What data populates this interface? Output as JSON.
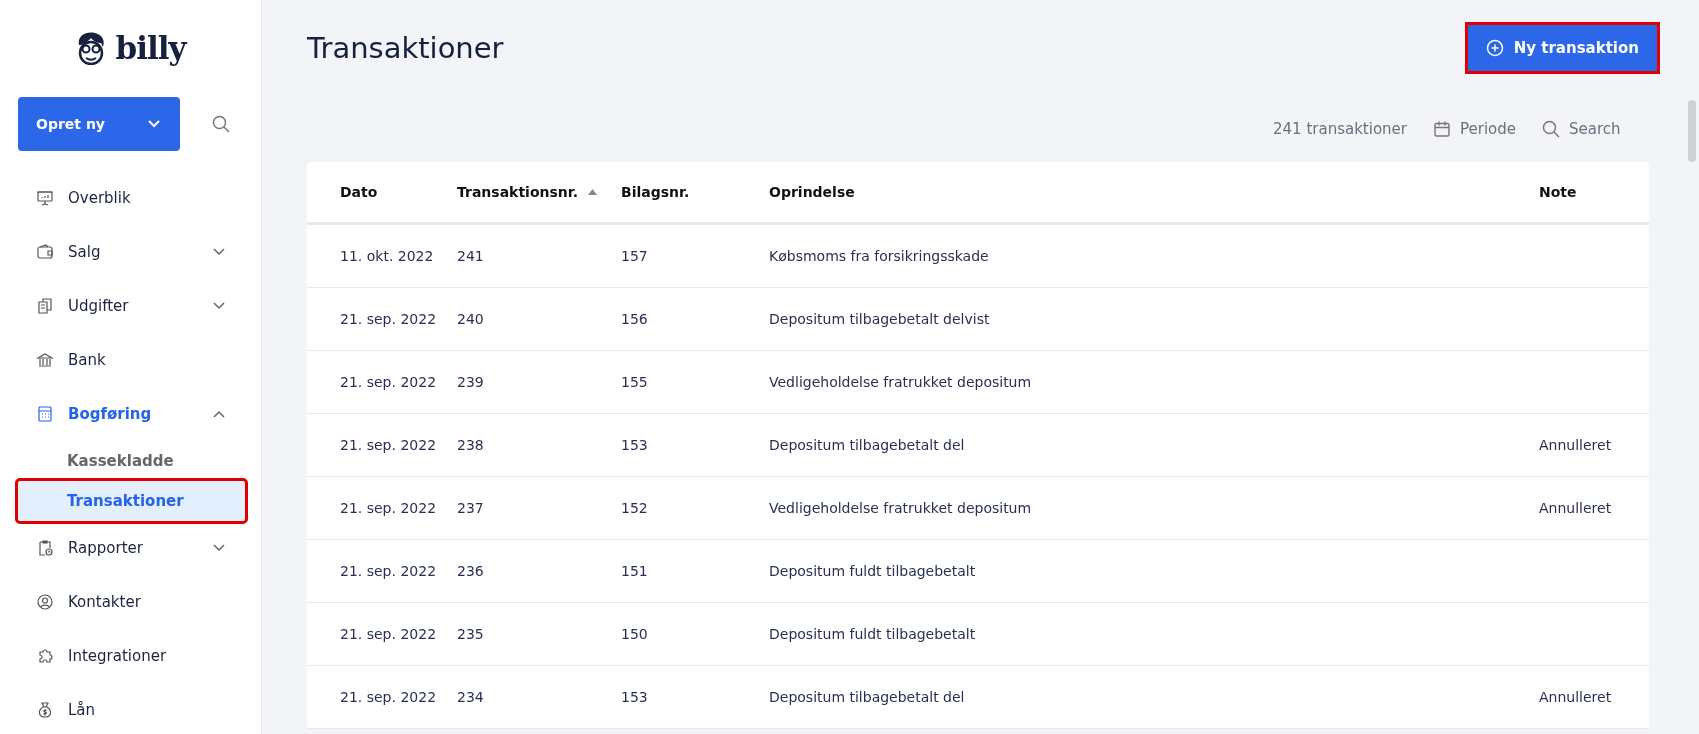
{
  "brand": {
    "name": "billy"
  },
  "create_button": {
    "label": "Opret ny"
  },
  "sidebar": {
    "items": [
      {
        "label": "Overblik",
        "selected": false
      },
      {
        "label": "Salg",
        "selected": false,
        "expanded": false
      },
      {
        "label": "Udgifter",
        "selected": false,
        "expanded": false
      },
      {
        "label": "Bank",
        "selected": false
      },
      {
        "label": "Bogføring",
        "selected": true,
        "expanded": true,
        "children": [
          {
            "label": "Kassekladde",
            "selected": false,
            "highlighted": false
          },
          {
            "label": "Transaktioner",
            "selected": true,
            "highlighted": true
          }
        ]
      },
      {
        "label": "Rapporter",
        "selected": false,
        "expanded": false
      },
      {
        "label": "Kontakter",
        "selected": false
      },
      {
        "label": "Integrationer",
        "selected": false
      },
      {
        "label": "Lån",
        "selected": false
      }
    ]
  },
  "page": {
    "title": "Transaktioner",
    "new_button": {
      "label": "Ny transaktion",
      "highlighted": true
    },
    "count": "241 transaktioner",
    "period_button": "Periode",
    "search_placeholder": "Search"
  },
  "table": {
    "columns": [
      {
        "label": "Dato",
        "sorted": false
      },
      {
        "label": "Transaktionsnr.",
        "sorted": true
      },
      {
        "label": "Bilagsnr.",
        "sorted": false
      },
      {
        "label": "Oprindelse",
        "sorted": false
      },
      {
        "label": "Note",
        "sorted": false
      }
    ],
    "rows": [
      [
        "11. okt. 2022",
        "241",
        "157",
        "Købsmoms fra forsikringsskade",
        ""
      ],
      [
        "21. sep. 2022",
        "240",
        "156",
        "Depositum tilbagebetalt delvist",
        ""
      ],
      [
        "21. sep. 2022",
        "239",
        "155",
        "Vedligeholdelse fratrukket depositum",
        ""
      ],
      [
        "21. sep. 2022",
        "238",
        "153",
        "Depositum tilbagebetalt del",
        "Annulleret"
      ],
      [
        "21. sep. 2022",
        "237",
        "152",
        "Vedligeholdelse fratrukket depositum",
        "Annulleret"
      ],
      [
        "21. sep. 2022",
        "236",
        "151",
        "Depositum fuldt tilbagebetalt",
        ""
      ],
      [
        "21. sep. 2022",
        "235",
        "150",
        "Depositum fuldt tilbagebetalt",
        ""
      ],
      [
        "21. sep. 2022",
        "234",
        "153",
        "Depositum tilbagebetalt del",
        "Annulleret"
      ]
    ]
  }
}
